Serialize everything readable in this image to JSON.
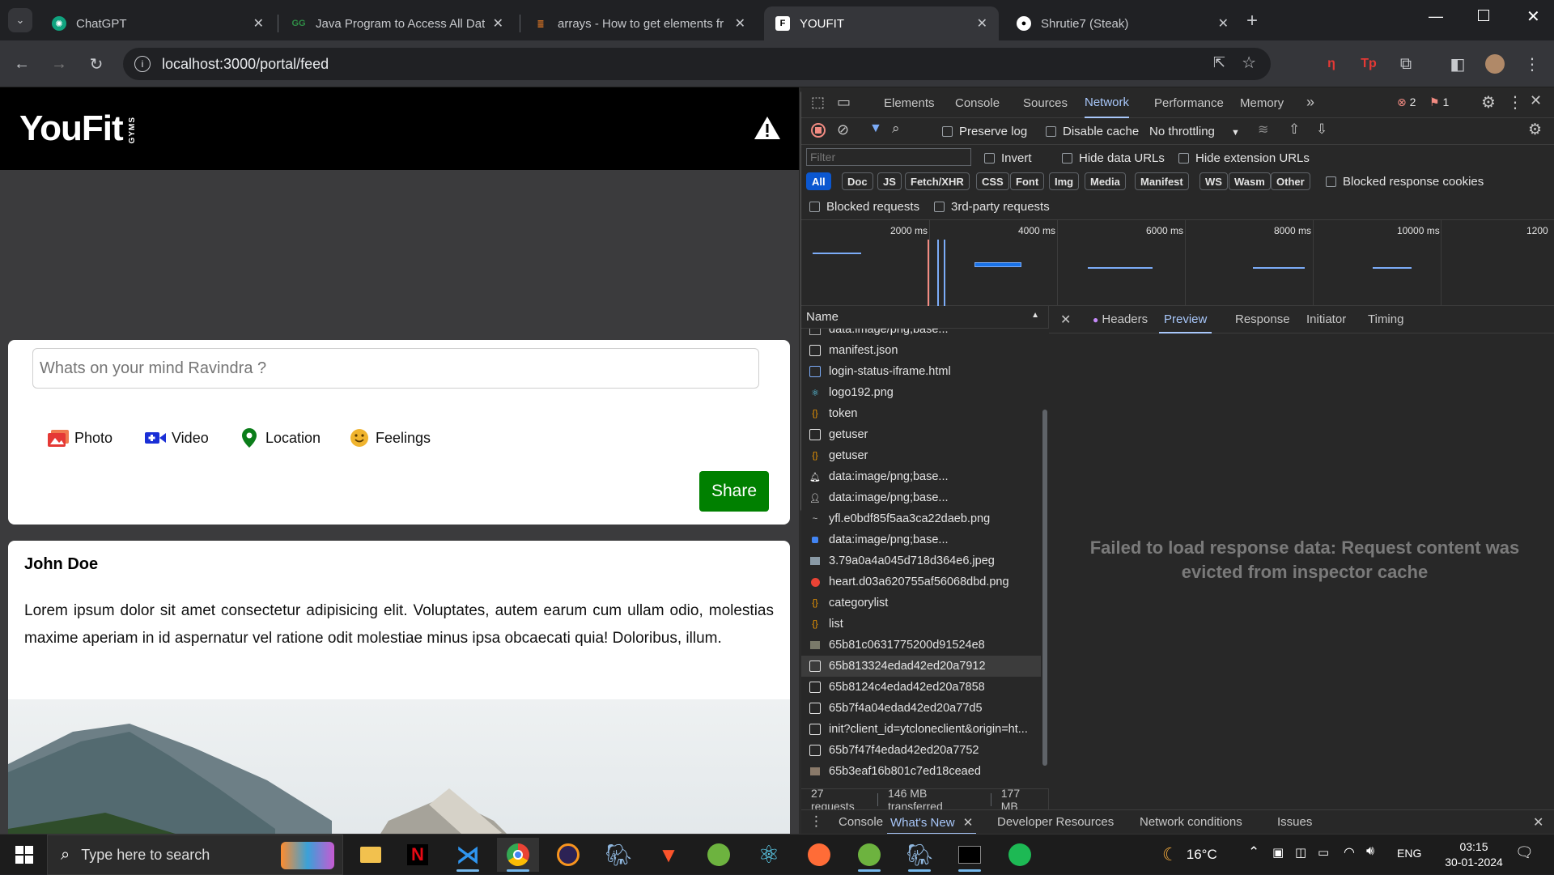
{
  "browser": {
    "tabs": [
      {
        "title": "ChatGPT",
        "icon": "chatgpt-icon"
      },
      {
        "title": "Java Program to Access All Data",
        "icon": "geeksforgeeks-icon"
      },
      {
        "title": "arrays - How to get elements fr",
        "icon": "stackoverflow-icon"
      },
      {
        "title": "YOUFIT",
        "icon": "youfit-icon"
      },
      {
        "title": "Shrutie7 (Steak)",
        "icon": "github-icon"
      }
    ],
    "url": "localhost:3000/portal/feed"
  },
  "page": {
    "logo": "YouFit",
    "logo_sub": "GYMS",
    "composer": {
      "placeholder": "Whats on your mind Ravindra ?",
      "options": [
        "Photo",
        "Video",
        "Location",
        "Feelings"
      ],
      "share_label": "Share"
    },
    "post": {
      "author": "John Doe",
      "body": "Lorem ipsum dolor sit amet consectetur adipisicing elit. Voluptates, autem earum cum ullam odio, molestias maxime aperiam in id aspernatur vel ratione odit molestiae minus ipsa obcaecati quia! Doloribus, illum."
    }
  },
  "devtools": {
    "tabs": [
      "Elements",
      "Console",
      "Sources",
      "Network",
      "Performance",
      "Memory"
    ],
    "active_tab": "Network",
    "error_count": "2",
    "warning_count": "1",
    "toolbar": {
      "preserve_log": "Preserve log",
      "disable_cache": "Disable cache",
      "throttling": "No throttling"
    },
    "filter": {
      "placeholder": "Filter",
      "invert": "Invert",
      "hide_data_urls": "Hide data URLs",
      "hide_extension_urls": "Hide extension URLs"
    },
    "type_filters": [
      "All",
      "Doc",
      "JS",
      "Fetch/XHR",
      "CSS",
      "Font",
      "Img",
      "Media",
      "Manifest",
      "WS",
      "Wasm",
      "Other"
    ],
    "blocked_cookies": "Blocked response cookies",
    "blocked_requests": "Blocked requests",
    "third_party": "3rd-party requests",
    "timeline_ticks": [
      "2000 ms",
      "4000 ms",
      "6000 ms",
      "8000 ms",
      "10000 ms",
      "1200"
    ],
    "name_header": "Name",
    "requests": [
      "data:image/png;base...",
      "manifest.json",
      "login-status-iframe.html",
      "logo192.png",
      "token",
      "getuser",
      "getuser",
      "data:image/png;base...",
      "data:image/png;base...",
      "yfl.e0bdf85f5aa3ca22daeb.png",
      "data:image/png;base...",
      "3.79a0a4a045d718d364e6.jpeg",
      "heart.d03a620755af56068dbd.png",
      "categorylist",
      "list",
      "65b81c0631775200d91524e8",
      "65b813324edad42ed20a7912",
      "65b8124c4edad42ed20a7858",
      "65b7f4a04edad42ed20a77d5",
      "init?client_id=ytcloneclient&origin=ht...",
      "65b7f47f4edad42ed20a7752",
      "65b3eaf16b801c7ed18ceaed"
    ],
    "detail_tabs": [
      "Headers",
      "Preview",
      "Response",
      "Initiator",
      "Timing"
    ],
    "detail_active": "Preview",
    "detail_message": "Failed to load response data: Request content was evicted from inspector cache",
    "status": {
      "requests": "27 requests",
      "transferred": "146 MB transferred",
      "resources": "177 MB"
    },
    "drawer_tabs": [
      "Console",
      "What's New",
      "Developer Resources",
      "Network conditions",
      "Issues"
    ]
  },
  "taskbar": {
    "search_placeholder": "Type here to search",
    "weather": "16°C",
    "language": "ENG",
    "time": "03:15",
    "date": "30-01-2024"
  }
}
